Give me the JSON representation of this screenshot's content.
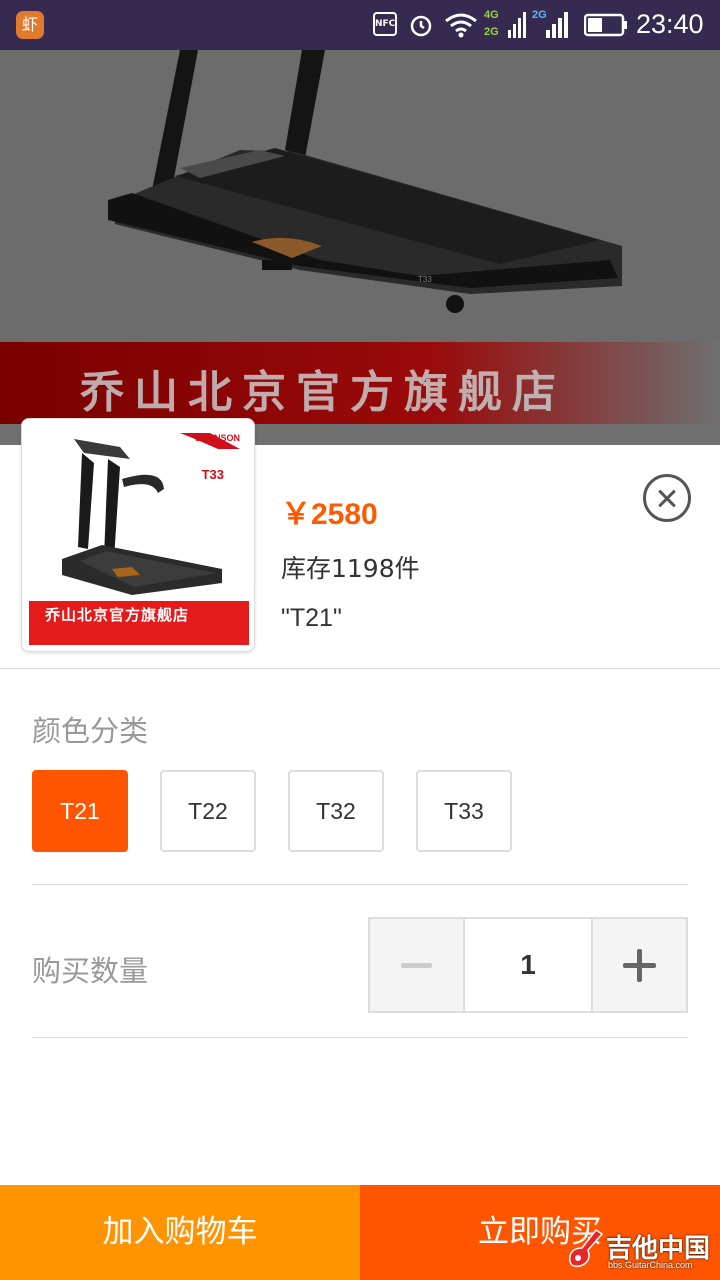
{
  "status_bar": {
    "app_icon": "虾",
    "nfc": "NFC",
    "net1_top": "4G",
    "net1_bottom": "2G",
    "net2": "2G",
    "time": "23:40"
  },
  "backdrop": {
    "banner_text": "乔山北京官方旗舰店"
  },
  "thumbnail": {
    "brand": "JOHNSON",
    "model": "T33",
    "banner_text": "乔山北京官方旗舰店"
  },
  "product": {
    "price": "￥2580",
    "stock": "库存1198件",
    "selected": "\"T21\""
  },
  "color_section": {
    "label": "颜色分类",
    "options": [
      "T21",
      "T22",
      "T32",
      "T33"
    ],
    "selected_index": 0
  },
  "quantity": {
    "label": "购买数量",
    "value": "1"
  },
  "actions": {
    "add_to_cart": "加入购物车",
    "buy_now": "立即购买"
  },
  "watermark": {
    "main": "吉他中国",
    "sub": "bbs.GuitarChina.com"
  },
  "colors": {
    "status_bar": "#362a51",
    "accent_orange": "#ff5500",
    "cart_orange": "#ff9400",
    "price": "#ff5a00"
  }
}
